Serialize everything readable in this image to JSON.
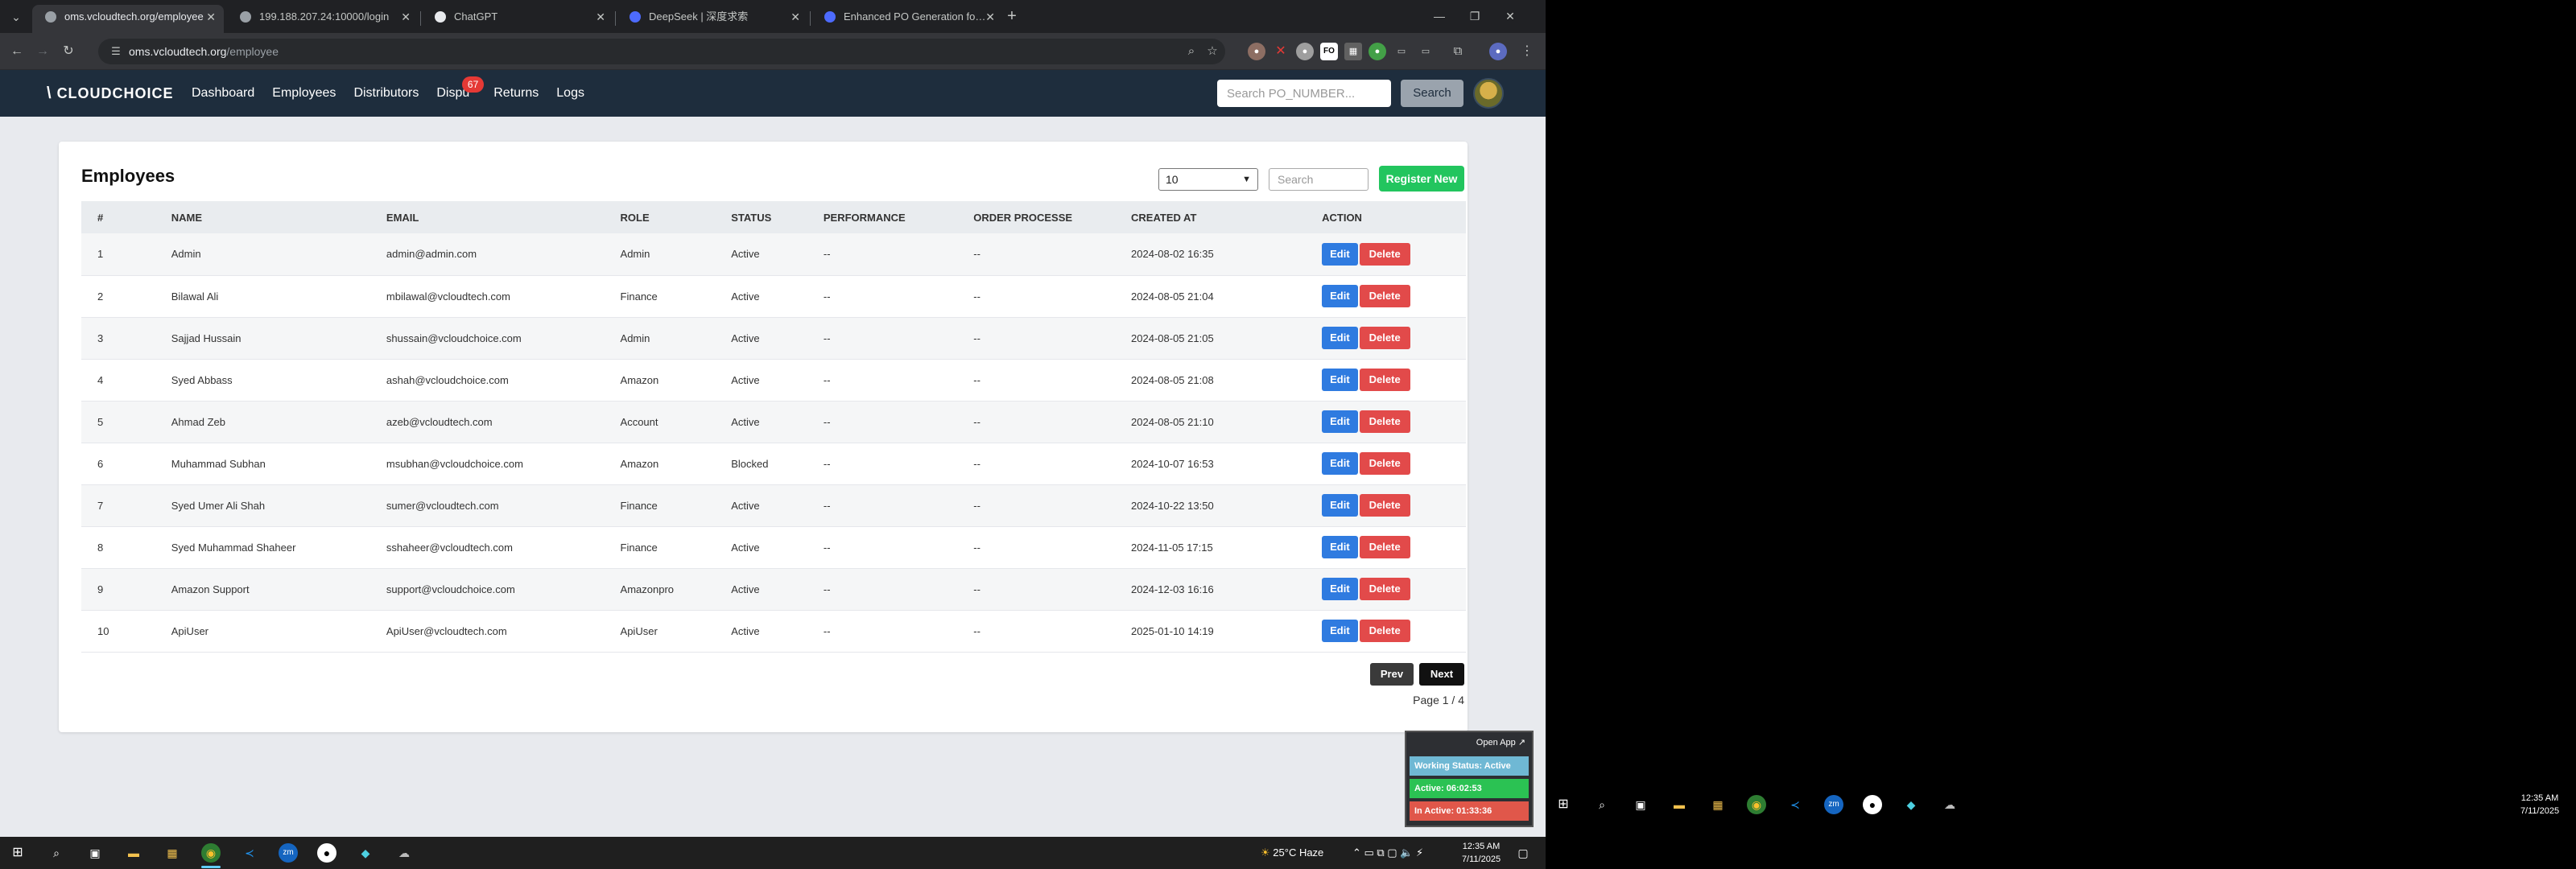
{
  "browser": {
    "tabs": [
      {
        "label": "oms.vcloudtech.org/employee",
        "active": true
      },
      {
        "label": "199.188.207.24:10000/login",
        "active": false
      },
      {
        "label": "ChatGPT",
        "active": false
      },
      {
        "label": "DeepSeek | 深度求索",
        "active": false
      },
      {
        "label": "Enhanced PO Generation for M",
        "active": false
      }
    ],
    "url_host": "oms.vcloudtech.org",
    "url_path": "/employee"
  },
  "site": {
    "logo_text": "CLOUDCHOICE",
    "nav": [
      {
        "label": "Dashboard"
      },
      {
        "label": "Employees"
      },
      {
        "label": "Distributors"
      },
      {
        "label": "Dispu",
        "badge": "67"
      },
      {
        "label": "Returns"
      },
      {
        "label": "Logs"
      }
    ],
    "po_search_placeholder": "Search PO_NUMBER...",
    "search_button": "Search"
  },
  "page": {
    "title": "Employees",
    "per_page": "10",
    "search_placeholder": "Search",
    "register_button": "Register New",
    "columns": [
      "#",
      "NAME",
      "EMAIL",
      "ROLE",
      "STATUS",
      "PERFORMANCE",
      "ORDER PROCESSE",
      "CREATED AT",
      "ACTION"
    ],
    "rows": [
      [
        "1",
        "Admin",
        "admin@admin.com",
        "Admin",
        "Active",
        "--",
        "--",
        "2024-08-02 16:35"
      ],
      [
        "2",
        "Bilawal Ali",
        "mbilawal@vcloudtech.com",
        "Finance",
        "Active",
        "--",
        "--",
        "2024-08-05 21:04"
      ],
      [
        "3",
        "Sajjad Hussain",
        "shussain@vcloudchoice.com",
        "Admin",
        "Active",
        "--",
        "--",
        "2024-08-05 21:05"
      ],
      [
        "4",
        "Syed Abbass",
        "ashah@vcloudchoice.com",
        "Amazon",
        "Active",
        "--",
        "--",
        "2024-08-05 21:08"
      ],
      [
        "5",
        "Ahmad Zeb",
        "azeb@vcloudtech.com",
        "Account",
        "Active",
        "--",
        "--",
        "2024-08-05 21:10"
      ],
      [
        "6",
        "Muhammad Subhan",
        "msubhan@vcloudchoice.com",
        "Amazon",
        "Blocked",
        "--",
        "--",
        "2024-10-07 16:53"
      ],
      [
        "7",
        "Syed Umer Ali Shah",
        "sumer@vcloudtech.com",
        "Finance",
        "Active",
        "--",
        "--",
        "2024-10-22 13:50"
      ],
      [
        "8",
        "Syed Muhammad Shaheer",
        "sshaheer@vcloudtech.com",
        "Finance",
        "Active",
        "--",
        "--",
        "2024-11-05 17:15"
      ],
      [
        "9",
        "Amazon Support",
        "support@vcloudchoice.com",
        "Amazonpro",
        "Active",
        "--",
        "--",
        "2024-12-03 16:16"
      ],
      [
        "10",
        "ApiUser",
        "ApiUser@vcloudtech.com",
        "ApiUser",
        "Active",
        "--",
        "--",
        "2025-01-10 14:19"
      ]
    ],
    "edit_label": "Edit",
    "delete_label": "Delete",
    "prev_label": "Prev",
    "next_label": "Next",
    "page_info": "Page 1 / 4"
  },
  "status_widget": {
    "open_app": "Open App ↗",
    "working_status": "Working Status: Active",
    "active_time": "Active: 06:02:53",
    "inactive_time": "In Active: 01:33:36"
  },
  "taskbar": {
    "weather": "25°C  Haze",
    "time": "12:35 AM",
    "date": "7/11/2025"
  },
  "colors": {
    "header_bg": "#1e2d3d",
    "register_green": "#22c55e",
    "edit_blue": "#2f7be0",
    "delete_red": "#e24a4a",
    "badge_red": "#e53935"
  }
}
